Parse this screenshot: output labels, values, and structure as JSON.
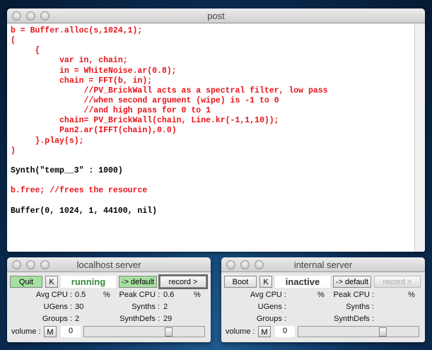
{
  "post": {
    "title": "post",
    "lines": [
      {
        "t": "b = Buffer.alloc(s,1024,1);",
        "c": "red"
      },
      {
        "t": "(",
        "c": "red"
      },
      {
        "t": "     {",
        "c": "red"
      },
      {
        "t": "          var in, chain;",
        "c": "red"
      },
      {
        "t": "          in = WhiteNoise.ar(0.8);",
        "c": "red"
      },
      {
        "t": "          chain = FFT(b, in);",
        "c": "red"
      },
      {
        "t": "               //PV_BrickWall acts as a spectral filter, low pass",
        "c": "red"
      },
      {
        "t": "               //when second argument (wipe) is -1 to 0",
        "c": "red"
      },
      {
        "t": "               //and high pass for 0 to 1",
        "c": "red"
      },
      {
        "t": "          chain= PV_BrickWall(chain, Line.kr(-1,1,10));",
        "c": "red"
      },
      {
        "t": "          Pan2.ar(IFFT(chain),0.0)",
        "c": "red"
      },
      {
        "t": "     }.play(s);",
        "c": "red"
      },
      {
        "t": ")",
        "c": "red"
      },
      {
        "t": "",
        "c": ""
      },
      {
        "t": "Synth(\"temp__3\" : 1000)",
        "c": ""
      },
      {
        "t": "",
        "c": ""
      },
      {
        "t": "b.free; //frees the resource",
        "c": "red"
      },
      {
        "t": "",
        "c": ""
      },
      {
        "t": "Buffer(0, 1024, 1, 44100, nil)",
        "c": ""
      }
    ]
  },
  "local": {
    "title": "localhost server",
    "boot": "Quit",
    "k": "K",
    "status": "running",
    "default": "-> default",
    "record": "record >",
    "avg_label": "Avg CPU :",
    "avg": "0.5",
    "pct": "%",
    "peak_label": "Peak CPU :",
    "peak": "0.6",
    "ugens_label": "UGens :",
    "ugens": "30",
    "synths_label": "Synths :",
    "synths": "2",
    "groups_label": "Groups :",
    "groups": "2",
    "defs_label": "SynthDefs :",
    "defs": "29",
    "volume_label": "volume :",
    "m": "M",
    "volume": "0"
  },
  "internal": {
    "title": "internal server",
    "boot": "Boot",
    "k": "K",
    "status": "inactive",
    "default": "-> default",
    "record": "record >",
    "avg_label": "Avg CPU :",
    "avg": "",
    "pct": "%",
    "peak_label": "Peak CPU :",
    "peak": "",
    "ugens_label": "UGens :",
    "ugens": "",
    "synths_label": "Synths :",
    "synths": "",
    "groups_label": "Groups :",
    "groups": "",
    "defs_label": "SynthDefs :",
    "defs": "",
    "volume_label": "volume :",
    "m": "M",
    "volume": "0"
  },
  "colors": {
    "code_red": "#e8141a",
    "running": "#3a8a3a",
    "green_button": "#a6e0a0"
  }
}
